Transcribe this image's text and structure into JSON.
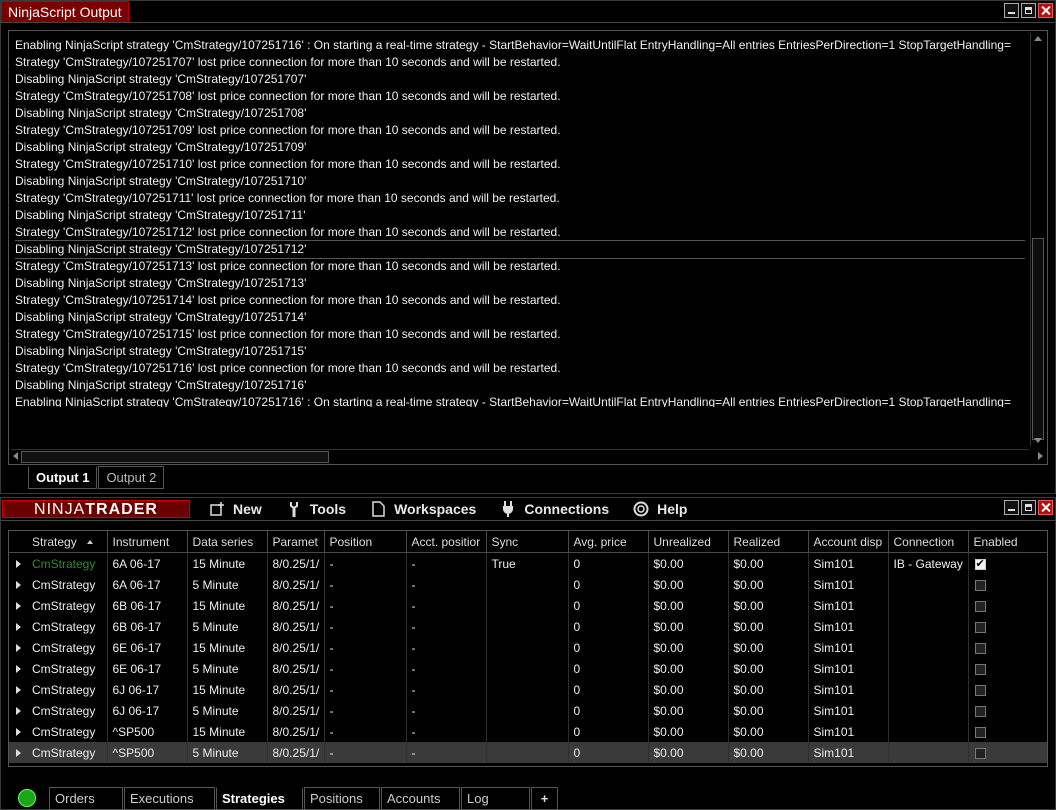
{
  "output_window": {
    "title": "NinjaScript Output",
    "lines": [
      "Enabling NinjaScript strategy 'CmStrategy/107251716' : On starting a real-time strategy - StartBehavior=WaitUntilFlat EntryHandling=All entries EntriesPerDirection=1 StopTargetHandling=",
      "Strategy 'CmStrategy/107251707' lost price connection for more than 10 seconds and will be restarted.",
      "Disabling NinjaScript strategy 'CmStrategy/107251707'",
      "Strategy 'CmStrategy/107251708' lost price connection for more than 10 seconds and will be restarted.",
      "Disabling NinjaScript strategy 'CmStrategy/107251708'",
      "Strategy 'CmStrategy/107251709' lost price connection for more than 10 seconds and will be restarted.",
      "Disabling NinjaScript strategy 'CmStrategy/107251709'",
      "Strategy 'CmStrategy/107251710' lost price connection for more than 10 seconds and will be restarted.",
      "Disabling NinjaScript strategy 'CmStrategy/107251710'",
      "Strategy 'CmStrategy/107251711' lost price connection for more than 10 seconds and will be restarted.",
      "Disabling NinjaScript strategy 'CmStrategy/107251711'",
      "Strategy 'CmStrategy/107251712' lost price connection for more than 10 seconds and will be restarted.",
      "Disabling NinjaScript strategy 'CmStrategy/107251712'",
      "Strategy 'CmStrategy/107251713' lost price connection for more than 10 seconds and will be restarted.",
      "Disabling NinjaScript strategy 'CmStrategy/107251713'",
      "Strategy 'CmStrategy/107251714' lost price connection for more than 10 seconds and will be restarted.",
      "Disabling NinjaScript strategy 'CmStrategy/107251714'",
      "Strategy 'CmStrategy/107251715' lost price connection for more than 10 seconds and will be restarted.",
      "Disabling NinjaScript strategy 'CmStrategy/107251715'",
      "Strategy 'CmStrategy/107251716' lost price connection for more than 10 seconds and will be restarted.",
      "Disabling NinjaScript strategy 'CmStrategy/107251716'",
      "Enabling NinjaScript strategy 'CmStrategy/107251716' : On starting a real-time strategy - StartBehavior=WaitUntilFlat EntryHandling=All entries EntriesPerDirection=1 StopTargetHandling="
    ],
    "tabs": [
      "Output 1",
      "Output 2"
    ]
  },
  "main_window": {
    "logo_left": "NINJA",
    "logo_right": "TRADER",
    "menu": [
      {
        "label": "New",
        "icon": "new-window-icon"
      },
      {
        "label": "Tools",
        "icon": "wrench-icon"
      },
      {
        "label": "Workspaces",
        "icon": "document-icon"
      },
      {
        "label": "Connections",
        "icon": "plug-icon"
      },
      {
        "label": "Help",
        "icon": "lifebuoy-icon"
      }
    ],
    "columns": [
      "Strategy",
      "Instrument",
      "Data series",
      "Paramet",
      "Position",
      "Acct. positior",
      "Sync",
      "Avg. price",
      "Unrealized",
      "Realized",
      "Account disp",
      "Connection",
      "Enabled"
    ],
    "rows": [
      {
        "strategy": "CmStrategy",
        "instrument": "6A 06-17",
        "series": "15 Minute",
        "params": "8/0.25/1/",
        "position": "-",
        "acct": "-",
        "sync": "True",
        "avg": "0",
        "unrealized": "$0.00",
        "realized": "$0.00",
        "account": "Sim101",
        "connection": "IB - Gateway",
        "enabled": true
      },
      {
        "strategy": "CmStrategy",
        "instrument": "6A 06-17",
        "series": "5 Minute",
        "params": "8/0.25/1/",
        "position": "-",
        "acct": "-",
        "sync": "",
        "avg": "0",
        "unrealized": "$0.00",
        "realized": "$0.00",
        "account": "Sim101",
        "connection": "",
        "enabled": false
      },
      {
        "strategy": "CmStrategy",
        "instrument": "6B 06-17",
        "series": "15 Minute",
        "params": "8/0.25/1/",
        "position": "-",
        "acct": "-",
        "sync": "",
        "avg": "0",
        "unrealized": "$0.00",
        "realized": "$0.00",
        "account": "Sim101",
        "connection": "",
        "enabled": false
      },
      {
        "strategy": "CmStrategy",
        "instrument": "6B 06-17",
        "series": "5 Minute",
        "params": "8/0.25/1/",
        "position": "-",
        "acct": "-",
        "sync": "",
        "avg": "0",
        "unrealized": "$0.00",
        "realized": "$0.00",
        "account": "Sim101",
        "connection": "",
        "enabled": false
      },
      {
        "strategy": "CmStrategy",
        "instrument": "6E 06-17",
        "series": "15 Minute",
        "params": "8/0.25/1/",
        "position": "-",
        "acct": "-",
        "sync": "",
        "avg": "0",
        "unrealized": "$0.00",
        "realized": "$0.00",
        "account": "Sim101",
        "connection": "",
        "enabled": false
      },
      {
        "strategy": "CmStrategy",
        "instrument": "6E 06-17",
        "series": "5 Minute",
        "params": "8/0.25/1/",
        "position": "-",
        "acct": "-",
        "sync": "",
        "avg": "0",
        "unrealized": "$0.00",
        "realized": "$0.00",
        "account": "Sim101",
        "connection": "",
        "enabled": false
      },
      {
        "strategy": "CmStrategy",
        "instrument": "6J 06-17",
        "series": "15 Minute",
        "params": "8/0.25/1/",
        "position": "-",
        "acct": "-",
        "sync": "",
        "avg": "0",
        "unrealized": "$0.00",
        "realized": "$0.00",
        "account": "Sim101",
        "connection": "",
        "enabled": false
      },
      {
        "strategy": "CmStrategy",
        "instrument": "6J 06-17",
        "series": "5 Minute",
        "params": "8/0.25/1/",
        "position": "-",
        "acct": "-",
        "sync": "",
        "avg": "0",
        "unrealized": "$0.00",
        "realized": "$0.00",
        "account": "Sim101",
        "connection": "",
        "enabled": false
      },
      {
        "strategy": "CmStrategy",
        "instrument": "^SP500",
        "series": "15 Minute",
        "params": "8/0.25/1/",
        "position": "-",
        "acct": "-",
        "sync": "",
        "avg": "0",
        "unrealized": "$0.00",
        "realized": "$0.00",
        "account": "Sim101",
        "connection": "",
        "enabled": false
      },
      {
        "strategy": "CmStrategy",
        "instrument": "^SP500",
        "series": "5 Minute",
        "params": "8/0.25/1/",
        "position": "-",
        "acct": "-",
        "sync": "",
        "avg": "0",
        "unrealized": "$0.00",
        "realized": "$0.00",
        "account": "Sim101",
        "connection": "",
        "enabled": false
      }
    ],
    "bottom_tabs": [
      "Orders",
      "Executions",
      "Strategies",
      "Positions",
      "Accounts",
      "Log"
    ],
    "active_tab": "Strategies",
    "add_tab_label": "+"
  },
  "colors": {
    "brand_red": "#7a0000",
    "active_strategy_green": "#2e8b2e",
    "connected_green": "#19a619"
  }
}
